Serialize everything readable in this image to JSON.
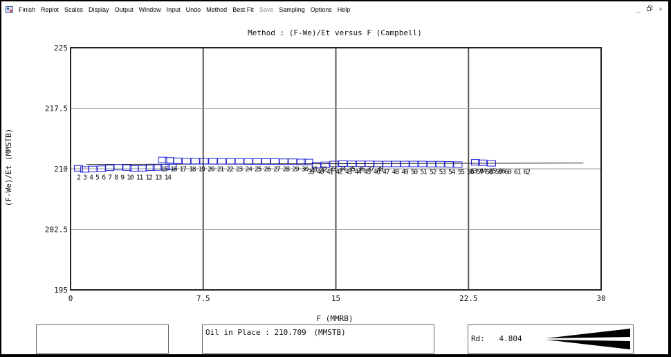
{
  "menu": {
    "items": [
      {
        "label": "Finish",
        "disabled": false
      },
      {
        "label": "Replot",
        "disabled": false
      },
      {
        "label": "Scales",
        "disabled": false
      },
      {
        "label": "Display",
        "disabled": false
      },
      {
        "label": "Output",
        "disabled": false
      },
      {
        "label": "Window",
        "disabled": false
      },
      {
        "label": "Input",
        "disabled": false
      },
      {
        "label": "Undo",
        "disabled": false
      },
      {
        "label": "Method",
        "disabled": false
      },
      {
        "label": "Best Fit",
        "disabled": false
      },
      {
        "label": "Save",
        "disabled": true
      },
      {
        "label": "Sampling",
        "disabled": false
      },
      {
        "label": "Options",
        "disabled": false
      },
      {
        "label": "Help",
        "disabled": false
      }
    ],
    "window_controls": [
      "_",
      "×"
    ]
  },
  "chart_data": {
    "type": "scatter",
    "title": "Method : (F-We)/Et versus F (Campbell)",
    "xlabel": "F (MMRB)",
    "ylabel": "(F-We)/Et (MMSTB)",
    "xlim": [
      0,
      30
    ],
    "ylim": [
      195,
      225
    ],
    "xticks": [
      0,
      7.5,
      15,
      22.5,
      30
    ],
    "yticks": [
      195,
      202.5,
      210,
      217.5,
      225
    ],
    "xticklabels": [
      "0",
      "7.5",
      "15",
      "22.5",
      "30"
    ],
    "yticklabels": [
      "195",
      "202.5",
      "210",
      "217.5",
      "225"
    ],
    "grid": true,
    "marker": "open-square",
    "marker_color": "#1f1fd6",
    "fit_line": {
      "x": [
        0.9,
        29.0
      ],
      "y": [
        210.55,
        210.72
      ]
    },
    "label_rows": [
      {
        "text": "2 3 4 5 6 7 8 9 10 11 12 13 14",
        "x": 0.35,
        "y": 209.0
      },
      {
        "text": "15 16 17 18 19 20 21 22 23 24 25 26 27 28 29 30 31 32 33 34 35 36 37 38",
        "x": 5.1,
        "y": 210.05
      },
      {
        "text": "39 40 41 42 43 44 45 46 47 48 49 50 51 52 53 54 55 56 57 58 59 60 61 62",
        "x": 13.4,
        "y": 209.7
      },
      {
        "text": "63 64 65 66",
        "x": 22.6,
        "y": 209.8
      }
    ],
    "points": [
      {
        "x": 0.45,
        "y": 210.06
      },
      {
        "x": 0.8,
        "y": 209.92
      },
      {
        "x": 1.25,
        "y": 209.98
      },
      {
        "x": 1.75,
        "y": 210.02
      },
      {
        "x": 2.2,
        "y": 210.12
      },
      {
        "x": 2.7,
        "y": 210.2
      },
      {
        "x": 3.2,
        "y": 210.14
      },
      {
        "x": 3.6,
        "y": 210.05
      },
      {
        "x": 4.05,
        "y": 210.06
      },
      {
        "x": 4.5,
        "y": 210.12
      },
      {
        "x": 4.9,
        "y": 210.16
      },
      {
        "x": 5.35,
        "y": 210.2
      },
      {
        "x": 5.75,
        "y": 210.24
      },
      {
        "x": 5.2,
        "y": 211.1
      },
      {
        "x": 5.6,
        "y": 211.05
      },
      {
        "x": 6.05,
        "y": 211.0
      },
      {
        "x": 6.55,
        "y": 210.95
      },
      {
        "x": 7.05,
        "y": 210.95
      },
      {
        "x": 7.55,
        "y": 210.95
      },
      {
        "x": 8.05,
        "y": 210.93
      },
      {
        "x": 8.55,
        "y": 210.93
      },
      {
        "x": 9.05,
        "y": 210.92
      },
      {
        "x": 9.55,
        "y": 210.92
      },
      {
        "x": 10.05,
        "y": 210.9
      },
      {
        "x": 10.55,
        "y": 210.9
      },
      {
        "x": 11.05,
        "y": 210.9
      },
      {
        "x": 11.55,
        "y": 210.9
      },
      {
        "x": 12.05,
        "y": 210.88
      },
      {
        "x": 12.55,
        "y": 210.88
      },
      {
        "x": 13.05,
        "y": 210.86
      },
      {
        "x": 13.45,
        "y": 210.85
      },
      {
        "x": 13.9,
        "y": 210.45
      },
      {
        "x": 14.4,
        "y": 210.5
      },
      {
        "x": 14.9,
        "y": 210.6
      },
      {
        "x": 15.4,
        "y": 210.65
      },
      {
        "x": 15.9,
        "y": 210.62
      },
      {
        "x": 16.4,
        "y": 210.62
      },
      {
        "x": 16.9,
        "y": 210.62
      },
      {
        "x": 17.4,
        "y": 210.6
      },
      {
        "x": 17.9,
        "y": 210.6
      },
      {
        "x": 18.4,
        "y": 210.6
      },
      {
        "x": 18.9,
        "y": 210.6
      },
      {
        "x": 19.4,
        "y": 210.6
      },
      {
        "x": 19.9,
        "y": 210.6
      },
      {
        "x": 20.4,
        "y": 210.58
      },
      {
        "x": 20.9,
        "y": 210.58
      },
      {
        "x": 21.4,
        "y": 210.55
      },
      {
        "x": 21.9,
        "y": 210.52
      },
      {
        "x": 22.9,
        "y": 210.8
      },
      {
        "x": 23.3,
        "y": 210.75
      },
      {
        "x": 23.8,
        "y": 210.68
      }
    ]
  },
  "info": {
    "oil_in_place_label": "Oil in Place :",
    "oil_in_place_value": "210.709",
    "oil_in_place_unit": "(MMSTB)",
    "rd_label": "Rd:",
    "rd_value": "4.804"
  }
}
